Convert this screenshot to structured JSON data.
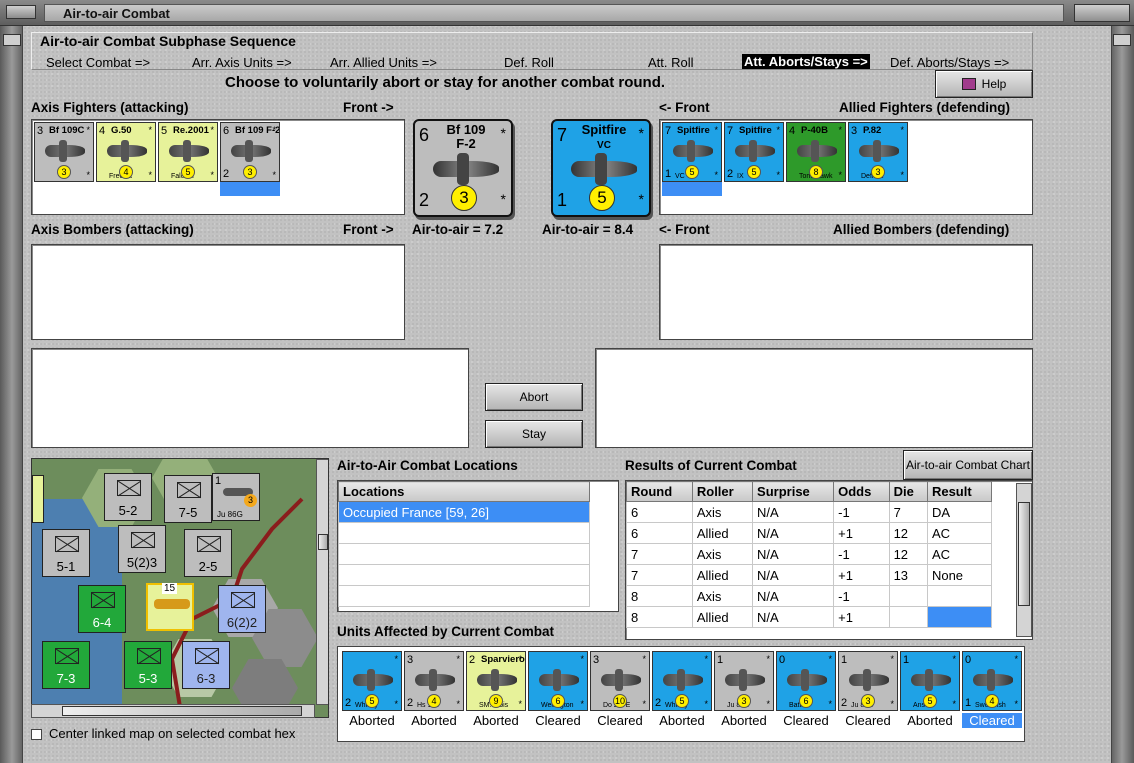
{
  "window": {
    "title": "Air-to-air Combat"
  },
  "phase": {
    "title": "Air-to-air Combat Subphase Sequence",
    "steps": [
      {
        "label": "Select Combat =>"
      },
      {
        "label": "Arr. Axis Units =>"
      },
      {
        "label": "Arr. Allied Units =>"
      },
      {
        "label": "Def. Roll"
      },
      {
        "label": "Att. Roll"
      },
      {
        "label": "Att. Aborts/Stays =>"
      },
      {
        "label": "Def. Aborts/Stays =>"
      }
    ],
    "active_index": 5
  },
  "instruction": "Choose to voluntarily abort or stay for another combat round.",
  "help_button": "Help",
  "axis_fighters": {
    "label": "Axis Fighters (attacking)",
    "front": "Front ->",
    "units": [
      {
        "att": "3",
        "name": "Bf 109C",
        "sub": "",
        "def": "",
        "range": "3",
        "color": "#bdbdbd"
      },
      {
        "att": "4",
        "name": "G.50",
        "sub": "Freccia",
        "def": "",
        "range": "4",
        "color": "#e7f29a"
      },
      {
        "att": "5",
        "name": "Re.2001",
        "sub": "Falco II",
        "def": "",
        "range": "5",
        "color": "#e7f29a"
      },
      {
        "att": "6",
        "name": "Bf 109 F-2",
        "sub": "",
        "def": "2",
        "range": "3",
        "color": "#bdbdbd"
      }
    ]
  },
  "allied_fighters": {
    "label": "Allied Fighters (defending)",
    "front": "<- Front",
    "units": [
      {
        "att": "7",
        "name": "Spitfire",
        "sub": "VC",
        "def": "1",
        "range": "5",
        "color": "#1fa2e6"
      },
      {
        "att": "7",
        "name": "Spitfire",
        "sub": "IX",
        "def": "2",
        "range": "5",
        "color": "#1fa2e6"
      },
      {
        "att": "4",
        "name": "P-40B",
        "sub": "Tomahawk",
        "def": "",
        "range": "8",
        "color": "#2e9a2a"
      },
      {
        "att": "3",
        "name": "P.82",
        "sub": "Defiant",
        "def": "",
        "range": "3",
        "color": "#1fa2e6"
      }
    ]
  },
  "axis_lead": {
    "att": "6",
    "name": "Bf 109 F-2",
    "def": "2",
    "range": "3",
    "color": "#bdbdbd"
  },
  "allied_lead": {
    "att": "7",
    "name": "Spitfire",
    "sub": "VC",
    "def": "1",
    "range": "5",
    "color": "#1fa2e6"
  },
  "axis_a2a": "Air-to-air = 7.2",
  "allied_a2a": "Air-to-air = 8.4",
  "axis_bombers": {
    "label": "Axis Bombers (attacking)",
    "front": "Front ->"
  },
  "allied_bombers": {
    "label": "Allied Bombers (defending)",
    "front": "<- Front"
  },
  "buttons": {
    "abort": "Abort",
    "stay": "Stay",
    "chart": "Air-to-air Combat Chart"
  },
  "locations": {
    "title": "Air-to-Air Combat Locations",
    "header": "Locations",
    "rows": [
      "Occupied France [59, 26]"
    ]
  },
  "results": {
    "title": "Results of Current Combat",
    "headers": [
      "Round",
      "Roller",
      "Surprise",
      "Odds",
      "Die",
      "Result"
    ],
    "rows": [
      [
        "6",
        "Axis",
        "N/A",
        "-1",
        "7",
        "DA"
      ],
      [
        "6",
        "Allied",
        "N/A",
        "+1",
        "12",
        "AC"
      ],
      [
        "7",
        "Axis",
        "N/A",
        "-1",
        "12",
        "AC"
      ],
      [
        "7",
        "Allied",
        "N/A",
        "+1",
        "13",
        "None"
      ],
      [
        "8",
        "Axis",
        "N/A",
        "-1",
        "",
        ""
      ],
      [
        "8",
        "Allied",
        "N/A",
        "+1",
        "",
        ""
      ]
    ]
  },
  "affected": {
    "title": "Units Affected by Current Combat",
    "units": [
      {
        "att": "",
        "name": "",
        "bottom": "Whitley",
        "def": "2",
        "range": "5",
        "status": "Aborted",
        "color": "#1fa2e6"
      },
      {
        "att": "3",
        "name": "",
        "bottom": "Hs 123",
        "def": "2",
        "range": "4",
        "status": "Aborted",
        "color": "#bdbdbd"
      },
      {
        "att": "2",
        "name": "Sparviero",
        "bottom": "SM.79bis",
        "def": "",
        "range": "9",
        "status": "Aborted",
        "color": "#e7f29a"
      },
      {
        "att": "",
        "name": "",
        "bottom": "Wellington",
        "def": "",
        "range": "6",
        "status": "Cleared",
        "color": "#1fa2e6"
      },
      {
        "att": "3",
        "name": "",
        "bottom": "Do 217E",
        "def": "",
        "range": "10",
        "status": "Cleared",
        "color": "#bdbdbd"
      },
      {
        "att": "",
        "name": "",
        "bottom": "Whitley",
        "def": "2",
        "range": "5",
        "status": "Aborted",
        "color": "#1fa2e6"
      },
      {
        "att": "1",
        "name": "",
        "bottom": "Ju 86G",
        "def": "",
        "range": "3",
        "status": "Aborted",
        "color": "#bdbdbd"
      },
      {
        "att": "0",
        "name": "",
        "bottom": "Battle",
        "def": "",
        "range": "6",
        "status": "Cleared",
        "color": "#1fa2e6"
      },
      {
        "att": "1",
        "name": "",
        "bottom": "Ju 86G",
        "def": "2",
        "range": "3",
        "status": "Cleared",
        "color": "#bdbdbd"
      },
      {
        "att": "1",
        "name": "",
        "bottom": "Anson",
        "def": "",
        "range": "5",
        "status": "Aborted",
        "color": "#1fa2e6"
      },
      {
        "att": "0",
        "name": "",
        "bottom": "Swordfish",
        "def": "1",
        "range": "4",
        "status": "Cleared",
        "color": "#1fa2e6"
      }
    ]
  },
  "map": {
    "units": [
      {
        "str": "5-2",
        "color": "#bdbdbd"
      },
      {
        "str": "7-5",
        "color": "#bdbdbd"
      },
      {
        "str": "5-1",
        "color": "#bdbdbd"
      },
      {
        "str": "5(2)3",
        "color": "#bdbdbd"
      },
      {
        "str": "2-5",
        "color": "#bdbdbd"
      },
      {
        "str": "6-4",
        "color": "#22a83a"
      },
      {
        "str": "6(2)2",
        "color": "#9fb5ee"
      },
      {
        "str": "7-3",
        "color": "#22a83a"
      },
      {
        "str": "5-3",
        "color": "#22a83a"
      },
      {
        "str": "6-3",
        "color": "#9fb5ee"
      }
    ],
    "air_unit": {
      "name": "Ju 86G",
      "att": "1",
      "range": "3"
    },
    "stack_count": "15"
  },
  "center_checkbox": "Center linked map on selected combat hex"
}
